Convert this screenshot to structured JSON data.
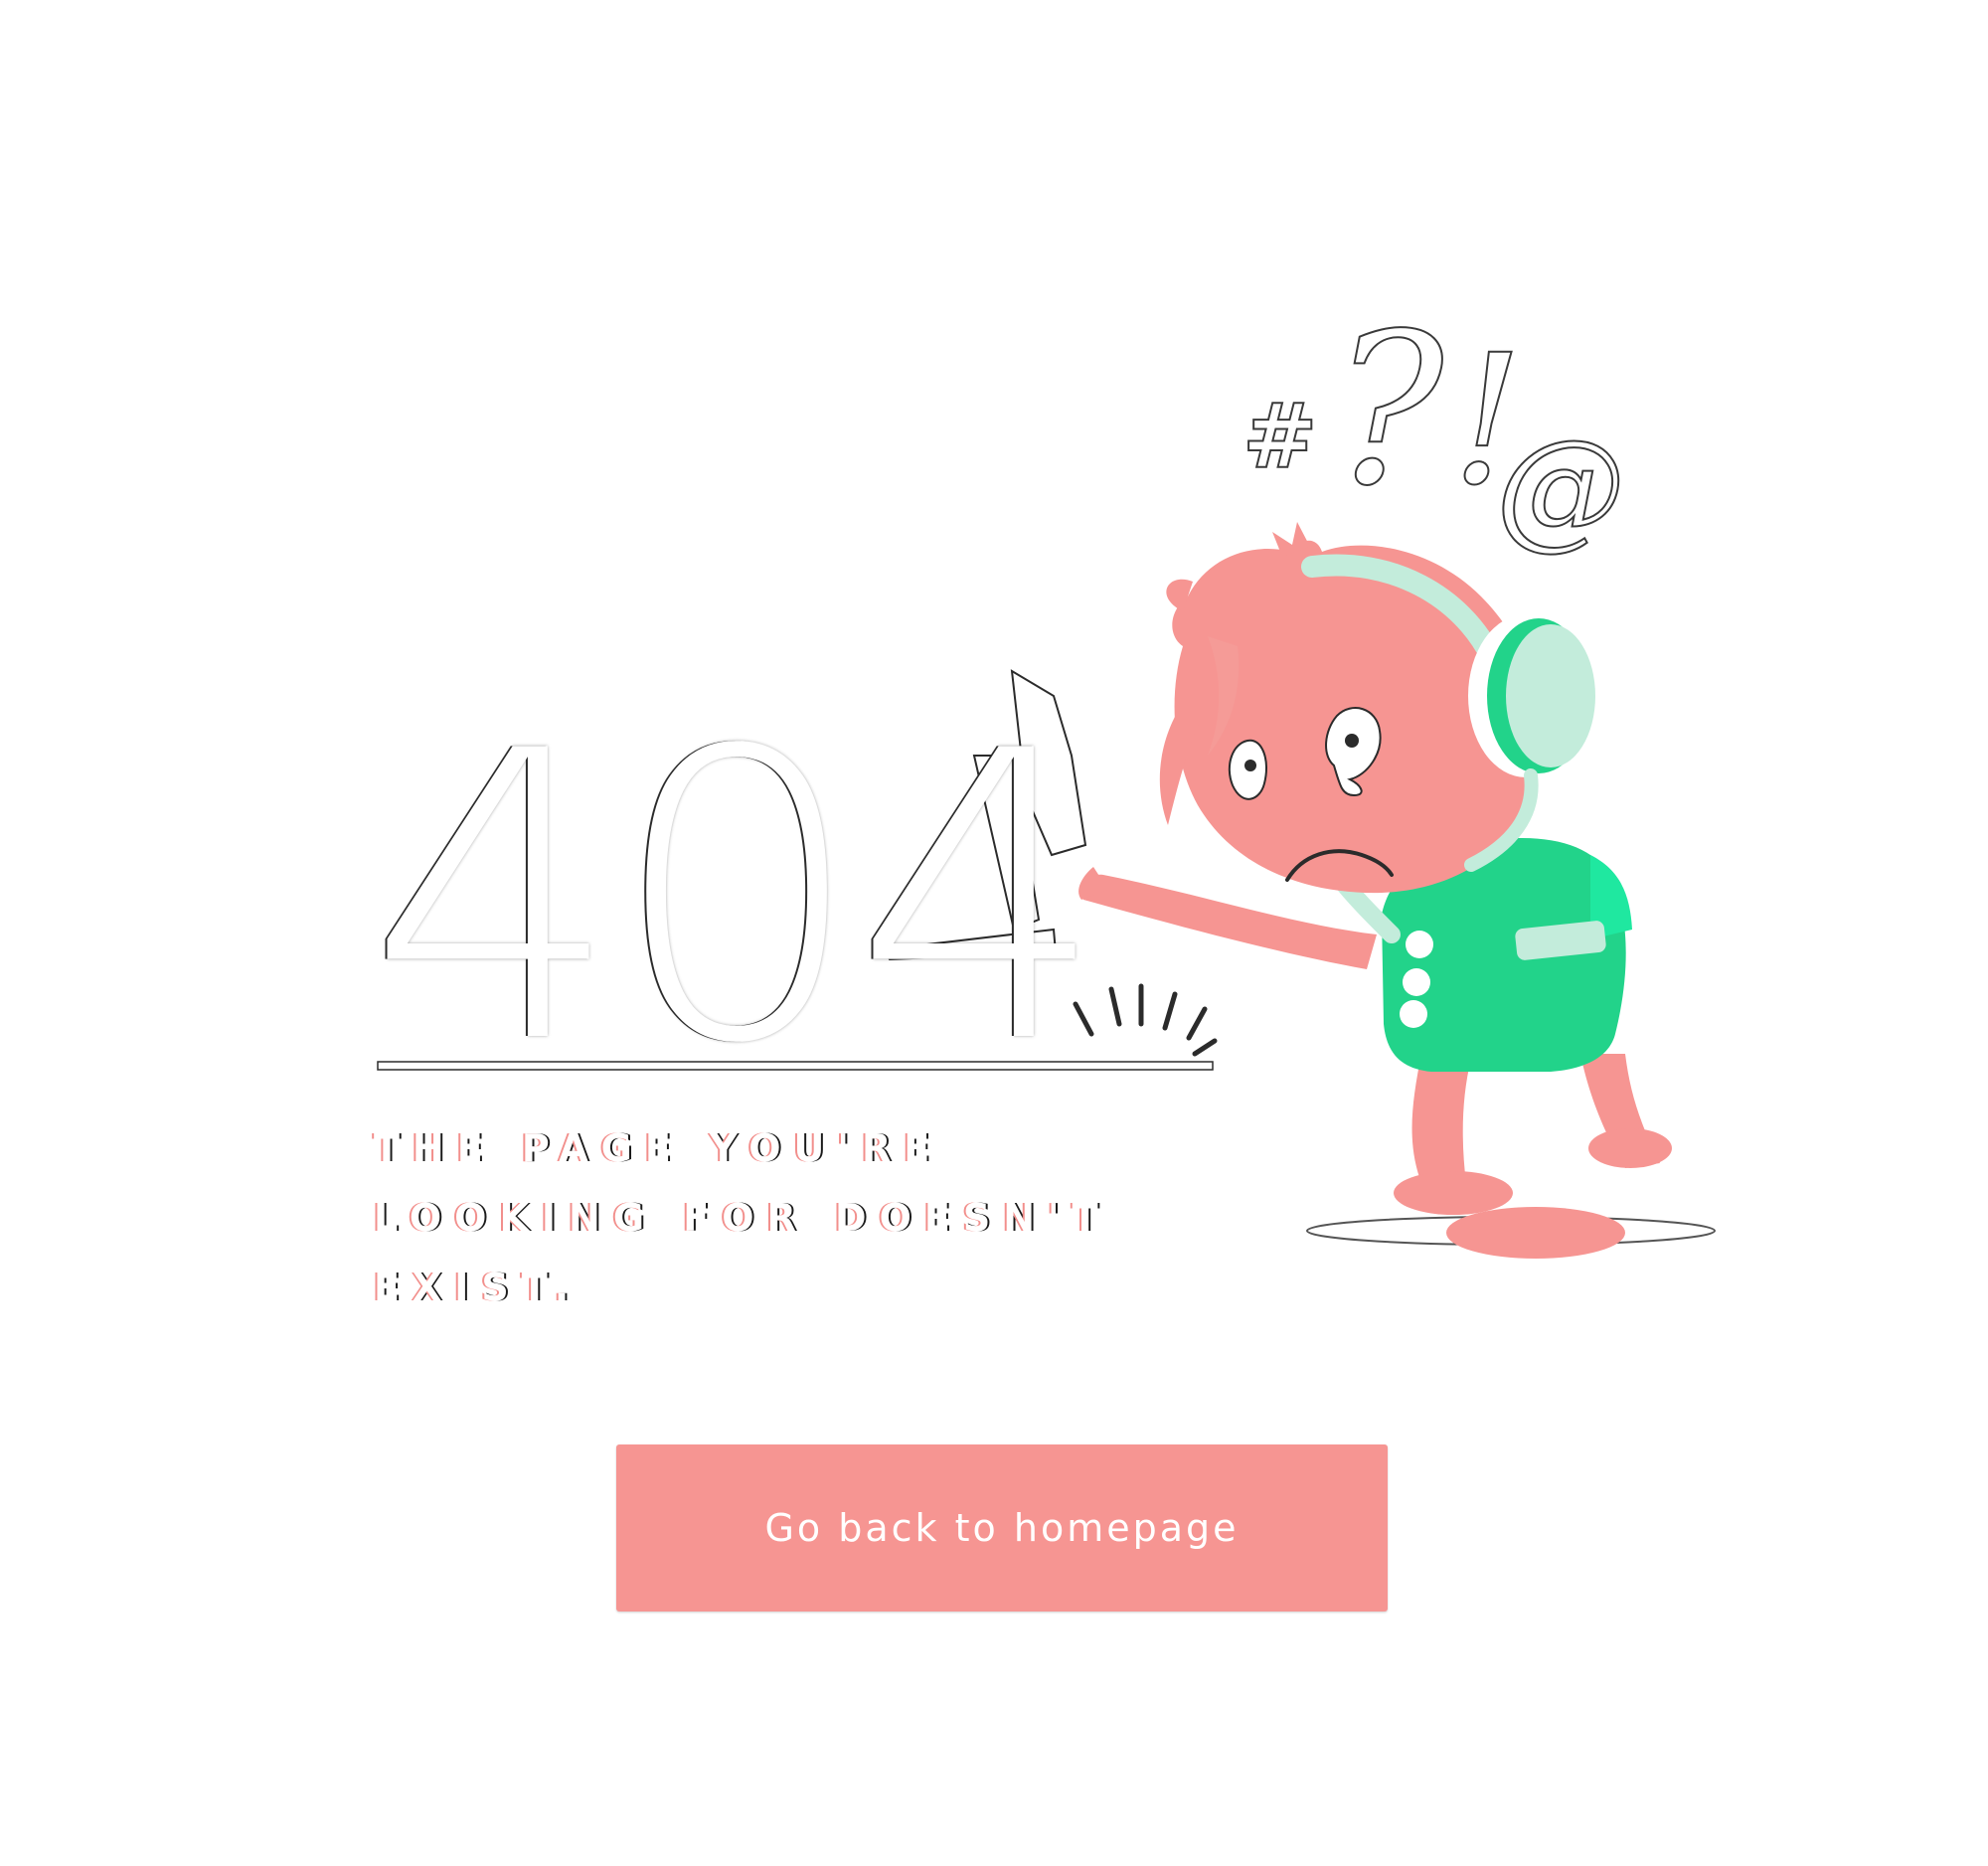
{
  "error": {
    "code": "404",
    "message": "THE PAGE YOU'RE LOOKING FOR DOESN'T EXIST."
  },
  "illustration": {
    "symbols": [
      "#",
      "?",
      "!",
      "@"
    ],
    "icon": "sad-character-with-headphones-icon"
  },
  "action": {
    "home_label": "Go back to homepage"
  },
  "colors": {
    "accent": "#f69592",
    "character_skin": "#f69592",
    "shirt": "#22d38a",
    "headphones": "#c3ecdb",
    "background": "#ffffff"
  }
}
